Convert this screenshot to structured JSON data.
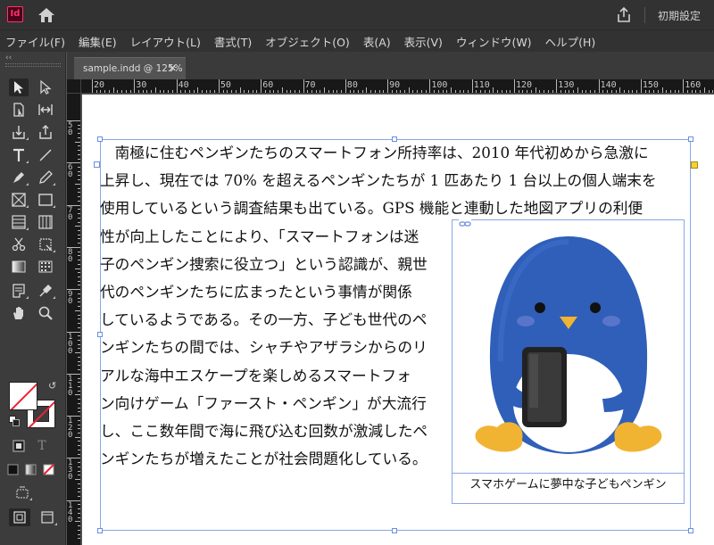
{
  "app": {
    "logo_text": "Id",
    "workspace_label": "初期設定",
    "accent_color": "#ff3366"
  },
  "menu": [
    "ファイル(F)",
    "編集(E)",
    "レイアウト(L)",
    "書式(T)",
    "オブジェクト(O)",
    "表(A)",
    "表示(V)",
    "ウィンドウ(W)",
    "ヘルプ(H)"
  ],
  "tools_panel": {
    "collapse_label": "‹‹",
    "preview_letter": "T"
  },
  "document_tab": {
    "title": "sample.indd @ 125%",
    "close_glyph": "✕"
  },
  "ruler": {
    "horizontal_labels": [
      "20",
      "30",
      "40",
      "50",
      "60",
      "70",
      "80",
      "90",
      "100",
      "110",
      "120",
      "130",
      "140",
      "150",
      "160"
    ],
    "vertical_labels": [
      "50",
      "60",
      "70",
      "80",
      "90",
      "100",
      "110",
      "120",
      "130",
      "140"
    ]
  },
  "document": {
    "body_lines": [
      "　南極に住むペンギンたちのスマートフォン所持率は、2010 年代初めから急激に",
      "上昇し、現在では 70% を超えるペンギンたちが 1 匹あたり 1 台以上の個人端末を",
      "使用しているという調査結果も出ている。GPS 機能と連動した地図アプリの利便",
      "性が向上したことにより、「スマートフォンは迷",
      "子のペンギン捜索に役立つ」という認識が、親世",
      "代のペンギンたちに広まったという事情が関係",
      "しているようである。その一方、子ども世代のペ",
      "ンギンたちの間では、シャチやアザラシからのリ",
      "アルな海中エスケープを楽しめるスマートフォ",
      "ン向けゲーム「ファースト・ペンギン」が大流行",
      "し、ここ数年間で海に飛び込む回数が激減したペ",
      "ンギンたちが増えたことが社会問題化している。"
    ],
    "image_caption": "スマホゲームに夢中な子どもペンギン",
    "frame_color": "#8aa6e6",
    "penguin_color": "#2f5fb8"
  }
}
